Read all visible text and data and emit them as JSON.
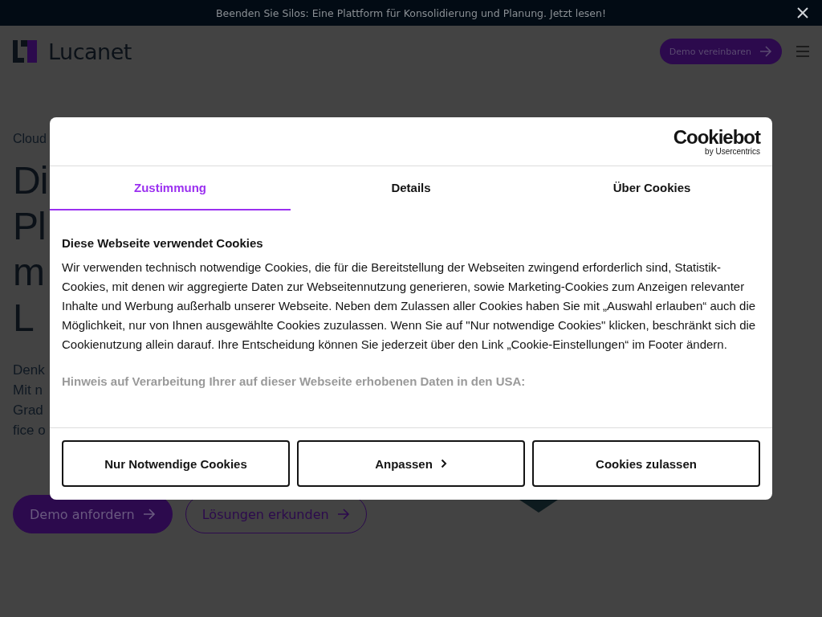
{
  "banner": {
    "text": "Beenden Sie Silos: Eine Plattform für Konsolidierung und Planung. Jetzt lesen!"
  },
  "header": {
    "logo": "Lucanet",
    "cta": "Demo vereinbaren"
  },
  "hero": {
    "eyebrow": "Cloud",
    "headline_lines": [
      "Di",
      "Pl",
      "m",
      "L"
    ],
    "body_lines": [
      "Denk",
      "Mit n",
      "Grad",
      "fice o"
    ],
    "buttons": [
      {
        "label": "Demo anfordern",
        "kind": "primary"
      },
      {
        "label": "Lösungen erkunden",
        "kind": "outline"
      }
    ]
  },
  "consent": {
    "brand": "Cookiebot",
    "brand_sub": "by Usercentrics",
    "tabs": [
      {
        "label": "Zustimmung",
        "selected": true
      },
      {
        "label": "Details",
        "selected": false
      },
      {
        "label": "Über Cookies",
        "selected": false
      }
    ],
    "heading": "Diese Webseite verwendet Cookies",
    "body": "Wir verwenden technisch notwendige Cookies, die für die Bereitstellung der Webseiten zwingend erforderlich sind, Statistik-Cookies, mit denen wir aggregierte Daten zur Webseitennutzung generieren, sowie Marketing-Cookies zum Anzeigen relevanter Inhalte und Werbung außerhalb unserer Webseite. Neben dem Zulassen aller Cookies haben Sie mit „Auswahl erlauben“ auch die Möglichkeit, nur von Ihnen ausgewählte Cookies zuzulassen. Wenn Sie auf \"Nur notwendige Cookies\" klicken, beschränkt sich die Cookienutzung allein darauf. Ihre Entscheidung können Sie jederzeit über den Link „Cookie-Einstellungen“ im Footer ändern.",
    "notice_heading": "Hinweis auf Verarbeitung Ihrer auf dieser Webseite erhobenen Daten in den USA:",
    "buttons": [
      {
        "label": "Nur Notwendige Cookies",
        "kind": "plain"
      },
      {
        "label": "Anpassen",
        "kind": "chevron"
      },
      {
        "label": "Cookies zulassen",
        "kind": "plain"
      }
    ]
  }
}
